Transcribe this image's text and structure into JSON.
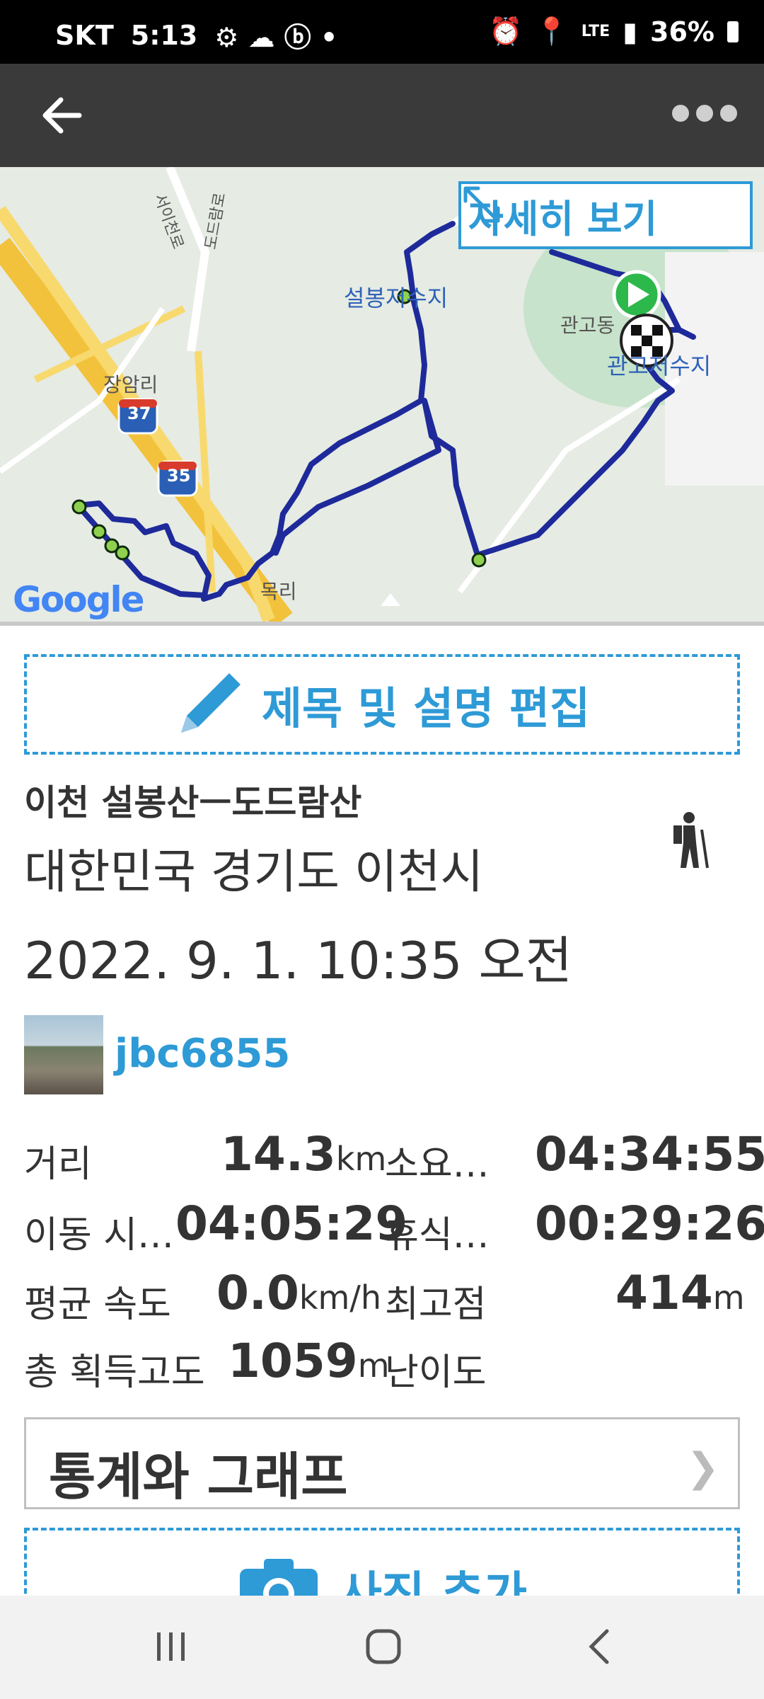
{
  "status": {
    "carrier": "SKT",
    "time": "5:13",
    "network": "LTE",
    "battery": "36%"
  },
  "appbar": {
    "back_icon": "back-arrow-icon",
    "more_icon": "more-dots-icon"
  },
  "map": {
    "detail_label": "자세히 보기",
    "labels": {
      "reservoir1": "설봉저수지",
      "district": "관고동",
      "reservoir2": "관고저수지",
      "village1": "장암리",
      "village2": "목리",
      "road_top": "서이천로",
      "road_top2": "도드람로",
      "route37": "37",
      "route35": "35"
    },
    "google": "Google"
  },
  "edit": {
    "label": "제목 및 설명 편집"
  },
  "track": {
    "title": "이천 설봉산ㅡ도드람산",
    "location": "대한민국 경기도 이천시",
    "datetime": "2022. 9. 1. 10:35 오전"
  },
  "user": {
    "name": "jbc6855"
  },
  "stats": {
    "distance_label": "거리",
    "distance_value": "14.3",
    "distance_unit": "km",
    "duration_label": "소요…",
    "duration_value": "04:34:55",
    "moving_label": "이동 시…",
    "moving_value": "04:05:29",
    "rest_label": "휴식…",
    "rest_value": "00:29:26",
    "avg_speed_label": "평균 속도",
    "avg_speed_value": "0.0",
    "avg_speed_unit": "km/h",
    "max_elev_label": "최고점",
    "max_elev_value": "414",
    "max_elev_unit": "m",
    "gain_label": "총 획득고도",
    "gain_value": "1059",
    "gain_unit": "m",
    "difficulty_label": "난이도"
  },
  "stats_button": {
    "label": "통계와 그래프",
    "chevron": "❯"
  },
  "photo": {
    "label": "사진 추가"
  },
  "colors": {
    "accent": "#2e9ad6",
    "route": "#1e2a9a",
    "appbar": "#3a3a3a"
  }
}
